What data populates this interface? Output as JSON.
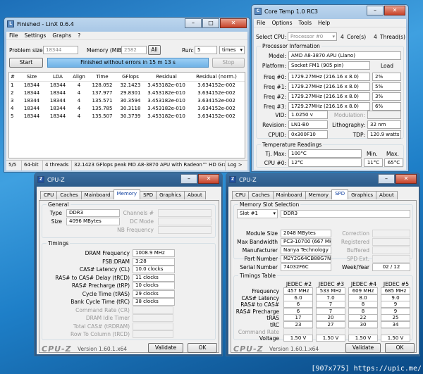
{
  "linx": {
    "title": "Finished - LinX 0.6.4",
    "menu": [
      "File",
      "Settings",
      "Graphs",
      "?"
    ],
    "problem_size_label": "Problem size:",
    "problem_size": "18344",
    "memory_label": "Memory (MiB):",
    "memory": "2582",
    "all_btn": "All",
    "run_label": "Run:",
    "run": "5",
    "run_unit": "times",
    "start_btn": "Start",
    "status": "Finished without errors in 15 m 13 s",
    "stop_btn": "Stop",
    "headers": [
      "#",
      "Size",
      "LDA",
      "Align",
      "Time",
      "GFlops",
      "Residual",
      "Residual (norm.)"
    ],
    "rows": [
      [
        "1",
        "18344",
        "18344",
        "4",
        "128.052",
        "32.1423",
        "3.453182e-010",
        "3.634152e-002"
      ],
      [
        "2",
        "18344",
        "18344",
        "4",
        "137.977",
        "29.8301",
        "3.453182e-010",
        "3.634152e-002"
      ],
      [
        "3",
        "18344",
        "18344",
        "4",
        "135.571",
        "30.3594",
        "3.453182e-010",
        "3.634152e-002"
      ],
      [
        "4",
        "18344",
        "18344",
        "4",
        "135.785",
        "30.3118",
        "3.453182e-010",
        "3.634152e-002"
      ],
      [
        "5",
        "18344",
        "18344",
        "4",
        "135.507",
        "30.3739",
        "3.453182e-010",
        "3.634152e-002"
      ]
    ],
    "statusbar": [
      "5/5",
      "64-bit",
      "4 threads",
      "32.1423 GFlops peak  MD A8-3870 APU with Radeon™ HD Graphic",
      "Log >"
    ]
  },
  "coretemp": {
    "title": "Core Temp 1.0 RC3",
    "menu": [
      "File",
      "Options",
      "Tools",
      "Help"
    ],
    "select_cpu_label": "Select CPU:",
    "cpu_select": "Processor #0",
    "cores": "4",
    "cores_label": "Core(s)",
    "threads": "4",
    "threads_label": "Thread(s)",
    "proc_info_label": "Processor Information",
    "model_label": "Model:",
    "model": "AMD A8-3870 APU (Llano)",
    "platform_label": "Platform:",
    "platform": "Socket FM1 (905 pin)",
    "load_label": "Load",
    "freqs": [
      {
        "label": "Freq #0:",
        "value": "1729.27MHz (216.16 x 8.0)",
        "load": "2%"
      },
      {
        "label": "Freq #1:",
        "value": "1729.27MHz (216.16 x 8.0)",
        "load": "5%"
      },
      {
        "label": "Freq #2:",
        "value": "1729.27MHz (216.16 x 8.0)",
        "load": "3%"
      },
      {
        "label": "Freq #3:",
        "value": "1729.27MHz (216.16 x 8.0)",
        "load": "6%"
      }
    ],
    "vid_label": "VID:",
    "vid": "1.0250 v",
    "modulation_label": "Modulation:",
    "revision_label": "Revision:",
    "revision": "LN1-B0",
    "lithography_label": "Lithography:",
    "lithography": "32 nm",
    "cpuid_label": "CPUID:",
    "cpuid": "0x300F10",
    "tdp_label": "TDP:",
    "tdp": "120.9 watts",
    "temp_label": "Temperature Readings",
    "tjmax_label": "Tj. Max:",
    "tjmax": "100°C",
    "min_label": "Min.",
    "max_label": "Max.",
    "cpu0_label": "CPU #0:",
    "cpu0": "12°C",
    "cpu0_min": "11°C",
    "cpu0_max": "65°C"
  },
  "cpuz_tabs_mem": [
    "CPU",
    "Caches",
    "Mainboard",
    "Memory",
    "SPD",
    "Graphics",
    "About"
  ],
  "cpuz_mem": {
    "title": "CPU-Z",
    "general_label": "General",
    "type_label": "Type",
    "type": "DDR3",
    "size_label": "Size",
    "size": "4096 MBytes",
    "channels_label": "Channels #",
    "dcmode_label": "DC Mode",
    "nbfreq_label": "NB Frequency",
    "timings_label": "Timings",
    "timings": [
      {
        "label": "DRAM Frequency",
        "value": "1008.9 MHz",
        "on": true
      },
      {
        "label": "FSB:DRAM",
        "value": "3:28",
        "on": true
      },
      {
        "label": "CAS# Latency (CL)",
        "value": "10.0 clocks",
        "on": true
      },
      {
        "label": "RAS# to CAS# Delay (tRCD)",
        "value": "11 clocks",
        "on": true
      },
      {
        "label": "RAS# Precharge (tRP)",
        "value": "10 clocks",
        "on": true
      },
      {
        "label": "Cycle Time (tRAS)",
        "value": "29 clocks",
        "on": true
      },
      {
        "label": "Bank Cycle Time (tRC)",
        "value": "38 clocks",
        "on": true
      },
      {
        "label": "Command Rate (CR)",
        "value": "",
        "on": false
      },
      {
        "label": "DRAM Idle Timer",
        "value": "",
        "on": false
      },
      {
        "label": "Total CAS# (tRDRAM)",
        "value": "",
        "on": false
      },
      {
        "label": "Row To Column (tRCD)",
        "value": "",
        "on": false
      }
    ],
    "logo": "CPU-Z",
    "version": "Version 1.60.1.x64",
    "validate_btn": "Validate",
    "ok_btn": "OK"
  },
  "cpuz_spd": {
    "title": "CPU-Z",
    "slot_label": "Memory Slot Selection",
    "slot": "Slot #1",
    "slot_type": "DDR3",
    "module_size_label": "Module Size",
    "module_size": "2048 MBytes",
    "max_bw_label": "Max Bandwidth",
    "max_bw": "PC3-10700 (667 MHz)",
    "manuf_label": "Manufacturer",
    "manuf": "Nanya Technology",
    "part_label": "Part Number",
    "part": "M2Y2G64CB88G7N-CG",
    "serial_label": "Serial Number",
    "serial": "74032F6C",
    "correction_label": "Correction",
    "registered_label": "Registered",
    "buffered_label": "Buffered",
    "spdext_label": "SPD Ext.",
    "weekyear_label": "Week/Year",
    "weekyear": "02 / 12",
    "tt_label": "Timings Table",
    "tt_headers": [
      "JEDEC #2",
      "JEDEC #3",
      "JEDEC #4",
      "JEDEC #5"
    ],
    "tt_rows": [
      {
        "label": "Frequency",
        "v": [
          "457 MHz",
          "533 MHz",
          "609 MHz",
          "685 MHz"
        ]
      },
      {
        "label": "CAS# Latency",
        "v": [
          "6.0",
          "7.0",
          "8.0",
          "9.0"
        ]
      },
      {
        "label": "RAS# to CAS#",
        "v": [
          "6",
          "7",
          "8",
          "9"
        ]
      },
      {
        "label": "RAS# Precharge",
        "v": [
          "6",
          "7",
          "8",
          "9"
        ]
      },
      {
        "label": "tRAS",
        "v": [
          "17",
          "20",
          "22",
          "25"
        ]
      },
      {
        "label": "tRC",
        "v": [
          "23",
          "27",
          "30",
          "34"
        ]
      },
      {
        "label": "Command Rate",
        "v": [
          "",
          "",
          "",
          ""
        ]
      },
      {
        "label": "Voltage",
        "v": [
          "1.50 V",
          "1.50 V",
          "1.50 V",
          "1.50 V"
        ]
      }
    ],
    "logo": "CPU-Z",
    "version": "Version 1.60.1.x64",
    "validate_btn": "Validate",
    "ok_btn": "OK"
  },
  "watermark": "[907x775] https://upic.me/"
}
